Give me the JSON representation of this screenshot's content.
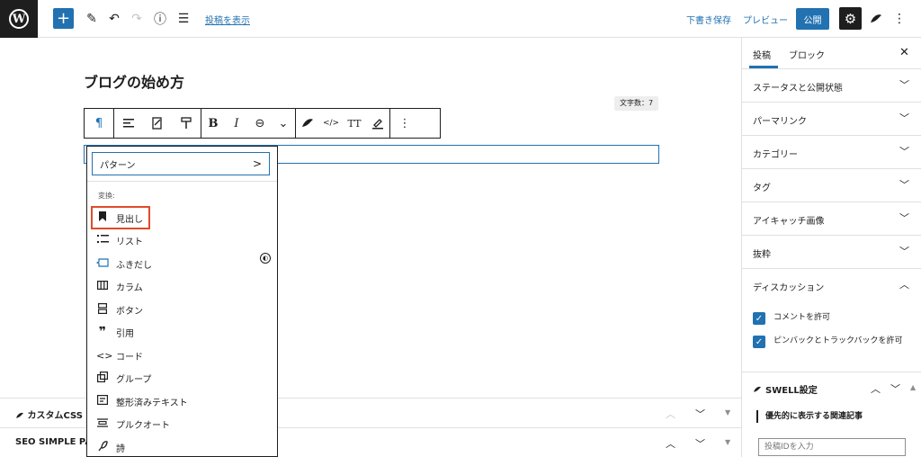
{
  "topbar": {
    "add_icon": "+",
    "pen_icon": "✎",
    "undo_icon": "↶",
    "redo_icon": "↷",
    "info_icon": "ⓘ",
    "list_view_icon": "☰",
    "view_post": "投稿を表示",
    "save_draft": "下書き保存",
    "preview": "プレビュー",
    "publish": "公開",
    "settings_icon": "⚙",
    "more_icon": "⋮"
  },
  "editor": {
    "title": "ブログの始め方",
    "word_count": "文字数：7"
  },
  "block_toolbar": {
    "paragraph_icon": "¶",
    "bold": "B",
    "italic": "I",
    "link_icon": "⊖",
    "more_chevron": "⌄",
    "code_icon": "</>",
    "font_size": "TT",
    "more_options": "⋮"
  },
  "dropdown": {
    "pattern_label": "パターン",
    "pattern_chevron": ">",
    "transform_label": "変換:",
    "items": [
      {
        "label": "見出し",
        "icon": "bookmark-icon"
      },
      {
        "label": "リスト",
        "icon": "list-icon"
      },
      {
        "label": "ふきだし",
        "icon": "balloon-icon"
      },
      {
        "label": "カラム",
        "icon": "columns-icon"
      },
      {
        "label": "ボタン",
        "icon": "button-icon"
      },
      {
        "label": "引用",
        "icon": "quote-icon"
      },
      {
        "label": "コード",
        "icon": "code-icon"
      },
      {
        "label": "グループ",
        "icon": "group-icon"
      },
      {
        "label": "整形済みテキスト",
        "icon": "preformatted-icon"
      },
      {
        "label": "プルクオート",
        "icon": "pullquote-icon"
      },
      {
        "label": "詩",
        "icon": "verse-icon"
      }
    ]
  },
  "meta_panels": [
    {
      "label": "カスタムCSS &"
    },
    {
      "label": "SEO SIMPLE PAC"
    }
  ],
  "sidebar": {
    "tab_post": "投稿",
    "tab_block": "ブロック",
    "close_icon": "✕",
    "panels": [
      "ステータスと公開状態",
      "パーマリンク",
      "カテゴリー",
      "タグ",
      "アイキャッチ画像",
      "抜粋",
      "ディスカッション"
    ],
    "allow_comments": "コメントを許可",
    "allow_pingbacks": "ピンバックとトラックバックを許可",
    "swell_title": "SWELL設定",
    "swell_related": "優先的に表示する関連記事",
    "swell_input_placeholder": "投稿IDを入力"
  },
  "colors": {
    "accent": "#2271b1",
    "highlight": "#e04b2b",
    "dark": "#1e1e1e"
  }
}
